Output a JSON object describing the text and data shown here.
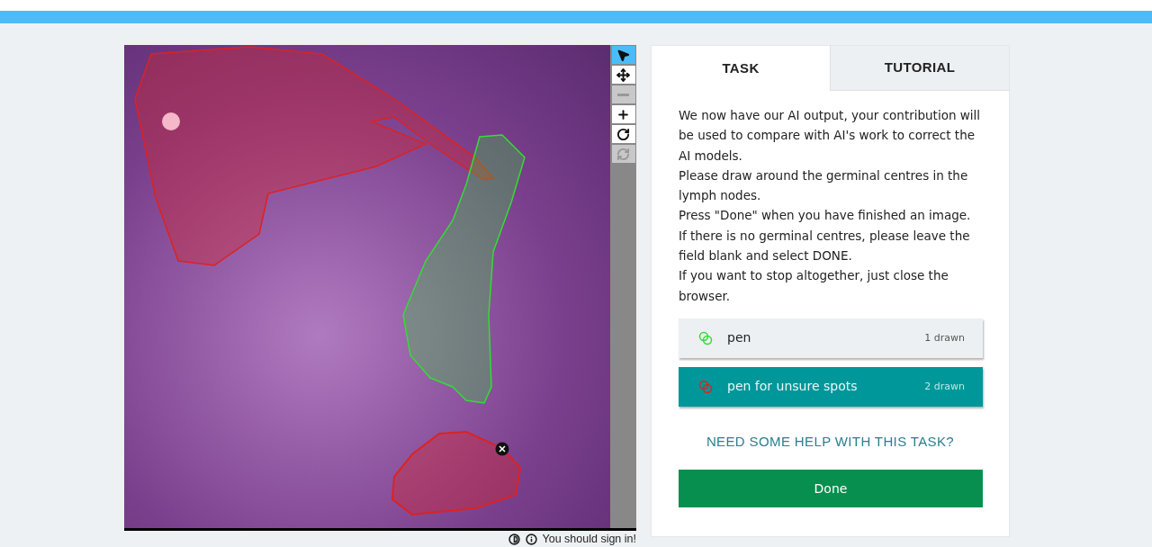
{
  "viewer": {
    "toolbar": [
      {
        "kind": "pointer",
        "selected": true,
        "disabled": false
      },
      {
        "kind": "move",
        "selected": false,
        "disabled": false
      },
      {
        "kind": "zoom-out",
        "selected": false,
        "disabled": true
      },
      {
        "kind": "zoom-in",
        "selected": false,
        "disabled": false
      },
      {
        "kind": "rotate",
        "selected": false,
        "disabled": false
      },
      {
        "kind": "reset",
        "selected": false,
        "disabled": true
      }
    ],
    "footer": "You should sign in!"
  },
  "tabs": [
    {
      "label": "TASK",
      "selected": true
    },
    {
      "label": "TUTORIAL",
      "selected": false
    }
  ],
  "instructions": [
    "We now have our AI output, your contribution will be used to compare with AI's work to correct the AI models.",
    "Please draw around the germinal centres in the lymph nodes.",
    "Press \"Done\" when you have finished an image.",
    "If there is no germinal centres, please leave the field blank and select DONE.",
    "If you want to stop altogether, just close the browser."
  ],
  "tools": [
    {
      "label": "pen",
      "count": "1 drawn",
      "color": "#33dd33",
      "selected": false
    },
    {
      "label": "pen for unsure spots",
      "count": "2 drawn",
      "color": "#dd2222",
      "selected": true
    }
  ],
  "help_link": "NEED SOME HELP WITH THIS TASK?",
  "done_button": "Done"
}
